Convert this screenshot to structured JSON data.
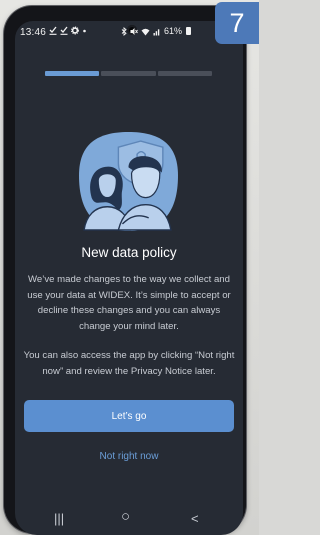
{
  "step_badge": "7",
  "status_bar": {
    "time": "13:46",
    "left_icons": [
      "download-icon",
      "download-icon",
      "gear-icon",
      "dot-icon"
    ],
    "right_icons": [
      "bluetooth-icon",
      "mute-icon",
      "wifi-icon",
      "signal-icon"
    ],
    "battery": "61%"
  },
  "progress": {
    "segments": 3,
    "current": 1
  },
  "content": {
    "illustration": "couple-with-privacy-shield",
    "title": "New data policy",
    "paragraph1": "We’ve made changes to the way we collect and use your data at WIDEX. It’s simple to accept or decline these changes and you can always change your mind later.",
    "paragraph2": "You can also access the app by clicking “Not right now” and review the Privacy Notice later."
  },
  "actions": {
    "primary_label": "Let’s go",
    "secondary_label": "Not right now"
  },
  "nav_bar": {
    "recents_glyph": "|||",
    "home_glyph": "○",
    "back_glyph": "<"
  },
  "colors": {
    "screen_background": "#262b34",
    "accent": "#5b8fd0",
    "link": "#6b9ed8",
    "badge": "#4d79b8"
  }
}
